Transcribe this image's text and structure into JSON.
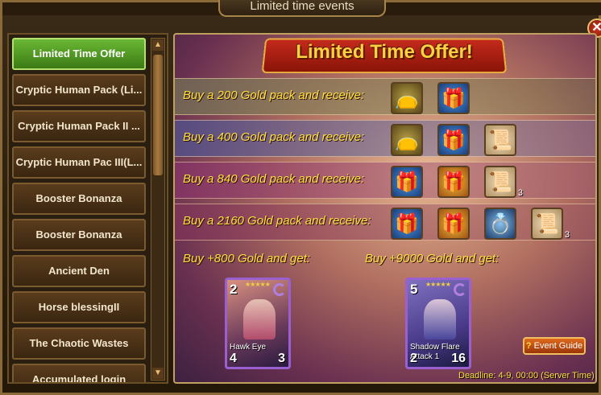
{
  "window": {
    "title": "Limited time events"
  },
  "sidebar": {
    "items": [
      {
        "label": "Limited Time Offer",
        "active": true
      },
      {
        "label": "Cryptic Human Pack (Li...",
        "active": false
      },
      {
        "label": "Cryptic Human Pack II ...",
        "active": false
      },
      {
        "label": "Cryptic Human Pac III(L...",
        "active": false
      },
      {
        "label": "Booster Bonanza",
        "active": false
      },
      {
        "label": "Booster Bonanza",
        "active": false
      },
      {
        "label": "Ancient Den",
        "active": false
      },
      {
        "label": "Horse blessingII",
        "active": false
      },
      {
        "label": "The Chaotic Wastes",
        "active": false
      },
      {
        "label": "Accumulated login",
        "active": false
      }
    ]
  },
  "main": {
    "banner": "Limited Time Offer!",
    "offers": [
      {
        "text": "Buy a 200 Gold pack and receive:",
        "rewards": [
          {
            "icon": "gold-bag-icon",
            "qty": ""
          },
          {
            "icon": "blue-gift-icon",
            "qty": ""
          }
        ]
      },
      {
        "text": "Buy a 400 Gold pack and receive:",
        "rewards": [
          {
            "icon": "gold-bag-icon",
            "qty": ""
          },
          {
            "icon": "blue-gift-icon",
            "qty": ""
          },
          {
            "icon": "scroll-icon",
            "qty": ""
          }
        ]
      },
      {
        "text": "Buy a 840 Gold pack and receive:",
        "rewards": [
          {
            "icon": "blue-gift-icon",
            "qty": ""
          },
          {
            "icon": "gold-gift-icon",
            "qty": ""
          },
          {
            "icon": "scroll-icon",
            "qty": "3"
          }
        ]
      },
      {
        "text": "Buy a 2160 Gold pack and receive:",
        "rewards": [
          {
            "icon": "blue-gift-icon",
            "qty": ""
          },
          {
            "icon": "gold-gift-icon",
            "qty": ""
          },
          {
            "icon": "ring-icon",
            "qty": ""
          },
          {
            "icon": "scroll-icon",
            "qty": "3"
          }
        ]
      }
    ],
    "get_800": "Buy +800 Gold and get:",
    "get_9000": "Buy +9000 Gold and get:",
    "cards": [
      {
        "cost": "2",
        "name": "Hawk Eye",
        "attack": "4",
        "health": "3",
        "stars": 5
      },
      {
        "cost": "5",
        "name": "Shadow Flare Attack 1",
        "attack": "2",
        "health": "16",
        "stars": 5
      }
    ],
    "event_guide": "Event Guide",
    "deadline": "Deadline: 4-9, 00:00 (Server Time)"
  },
  "colors": {
    "accent_gold": "#ffe040",
    "active_tab": "#3c7a16",
    "banner_red": "#c42a1c"
  }
}
